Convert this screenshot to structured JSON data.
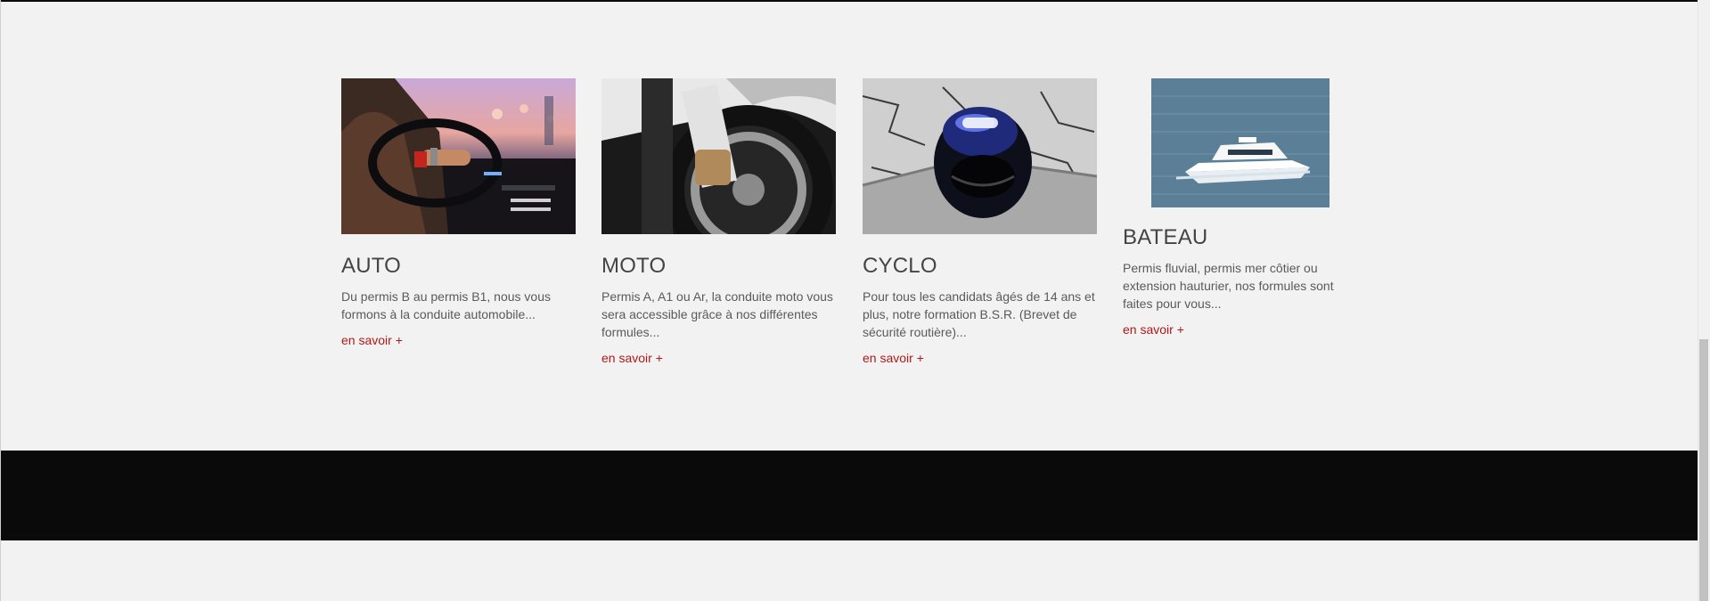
{
  "cards": [
    {
      "image_alt": "Conducteur au volant d'une voiture de nuit",
      "title": "AUTO",
      "text": "Du permis B au permis B1, nous vous formons à la conduite automobile...",
      "link": "en savoir +"
    },
    {
      "image_alt": "Roue avant de moto avec frein à disque",
      "title": "MOTO",
      "text": "Permis A, A1 ou Ar, la conduite moto vous sera accessible grâce à nos différentes formules...",
      "link": "en savoir +"
    },
    {
      "image_alt": "Casque de moto SHOEI posé sur un muret",
      "title": "CYCLO",
      "text": "Pour tous les candidats âgés de 14 ans et plus, notre formation B.S.R. (Brevet de sécurité routière)...",
      "link": "en savoir +"
    },
    {
      "image_alt": "Bateau à moteur blanc sur la mer",
      "title": "BATEAU",
      "text": "Permis fluvial, permis mer côtier ou extension hauturier, nos formules sont faites pour vous...",
      "link": "en savoir +"
    }
  ],
  "colors": {
    "background": "#f2f2f2",
    "heading": "#444444",
    "body_text": "#5a5a5a",
    "link": "#b01818",
    "footer_band": "#0a0a0a"
  }
}
